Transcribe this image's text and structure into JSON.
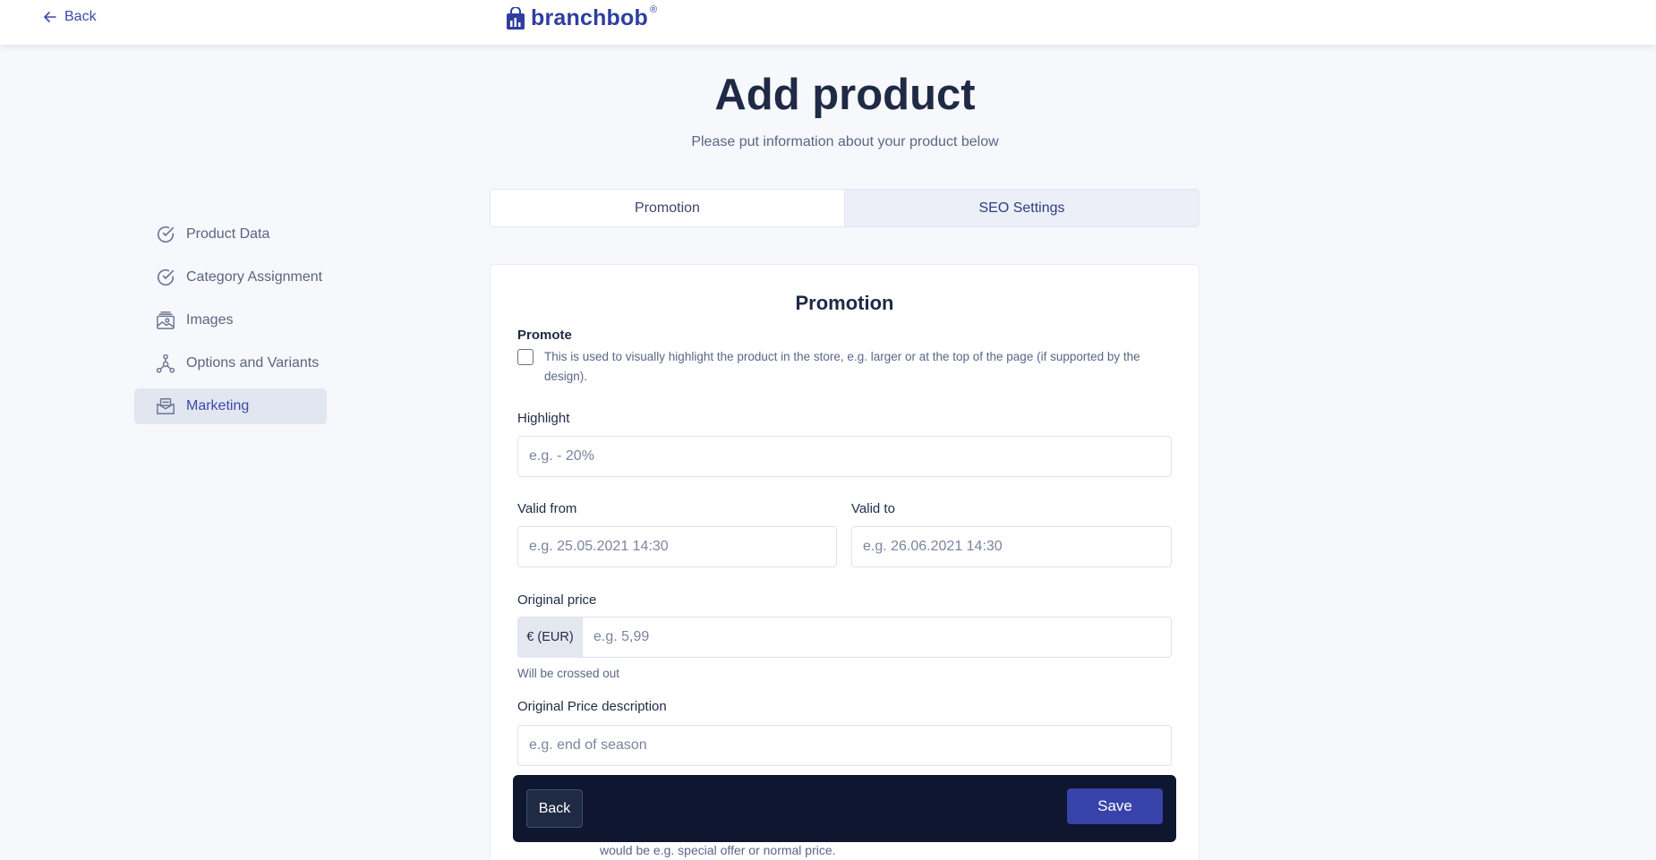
{
  "header": {
    "back_label": "Back",
    "brand": "branchbob",
    "brand_mark": "®"
  },
  "page": {
    "title": "Add product",
    "subtitle": "Please put information about your product below"
  },
  "sidebar": {
    "items": [
      {
        "label": "Product Data",
        "icon": "check-circle-icon",
        "active": false
      },
      {
        "label": "Category Assignment",
        "icon": "check-circle-icon",
        "active": false
      },
      {
        "label": "Images",
        "icon": "images-icon",
        "active": false
      },
      {
        "label": "Options and Variants",
        "icon": "variants-icon",
        "active": false
      },
      {
        "label": "Marketing",
        "icon": "marketing-icon",
        "active": true
      }
    ]
  },
  "tabs": [
    {
      "label": "Promotion",
      "active": true
    },
    {
      "label": "SEO Settings",
      "active": false
    }
  ],
  "form": {
    "title": "Promotion",
    "promote_label": "Promote",
    "promote_checked": false,
    "promote_help": "This is used to visually highlight the product in the store, e.g. larger or at the top of the page (if supported by the design).",
    "highlight_label": "Highlight",
    "highlight_placeholder": "e.g. - 20%",
    "valid_from_label": "Valid from",
    "valid_from_placeholder": "e.g. 25.05.2021 14:30",
    "valid_to_label": "Valid to",
    "valid_to_placeholder": "e.g. 26.06.2021 14:30",
    "original_price_label": "Original price",
    "currency": "€ (EUR)",
    "original_price_placeholder": "e.g. 5,99",
    "original_price_hint": "Will be crossed out",
    "price_desc_label": "Original Price description",
    "price_desc_placeholder": "e.g. end of season",
    "price_desc_hint_partial": "would be e.g. special offer or normal price."
  },
  "actions": {
    "back_label": "Back",
    "save_label": "Save"
  },
  "colors": {
    "brand": "#2f3e9e",
    "action_bar": "#0e1630",
    "save_button": "#3743a8"
  }
}
